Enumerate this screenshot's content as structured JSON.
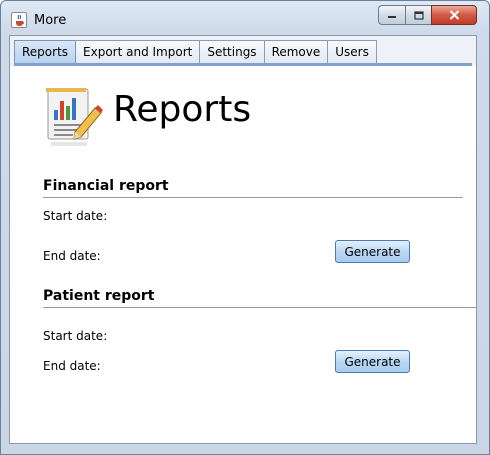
{
  "window": {
    "title": "More",
    "icon": "java-cup-icon",
    "controls": {
      "minimize_icon": "minimize-icon",
      "maximize_icon": "maximize-icon",
      "close_icon": "close-icon"
    }
  },
  "tabs": [
    {
      "label": "Reports",
      "active": true
    },
    {
      "label": "Export and Import",
      "active": false
    },
    {
      "label": "Settings",
      "active": false
    },
    {
      "label": "Remove",
      "active": false
    },
    {
      "label": "Users",
      "active": false
    }
  ],
  "reports": {
    "icon": "report-chart-pencil-icon",
    "heading": "Reports",
    "financial": {
      "title": "Financial report",
      "start_label": "Start date:",
      "end_label": "End date:",
      "button": "Generate"
    },
    "patient": {
      "title": "Patient report",
      "start_label": "Start date:",
      "end_label": "End date:",
      "button": "Generate"
    }
  },
  "colors": {
    "active_tab": "#b8d2ee",
    "button_fill": "#b7d6f3",
    "button_border": "#4c7bb3",
    "close_button": "#c23c27"
  }
}
